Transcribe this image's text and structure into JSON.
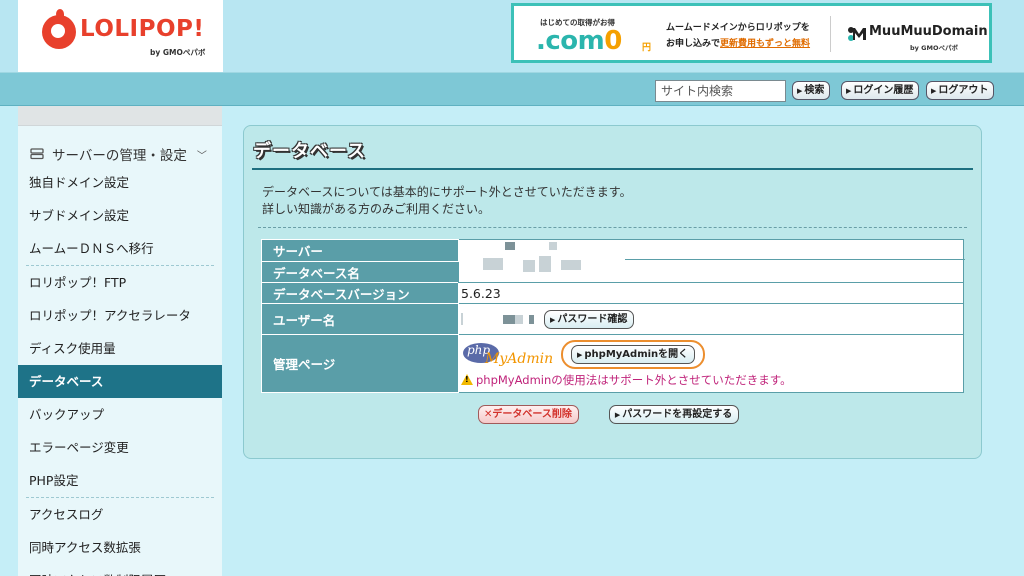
{
  "header": {
    "logo_text": "LOLIPOP!",
    "logo_sub": "by GMOペパボ",
    "banner": {
      "small": "はじめての取得がお得",
      "com": ".com",
      "zero": "0",
      "yen": "円",
      "line1": "ムームードメインからロリポップを",
      "line2_prefix": "お申し込みで",
      "line2_emph": "更新費用もずっと無料",
      "partner": "MuuMuuDomain",
      "partner_sub": "by GMOペパボ"
    }
  },
  "toolbar": {
    "search_placeholder": "サイト内検索",
    "search_button": "検索",
    "login_history_button": "ログイン履歴",
    "logout_button": "ログアウト"
  },
  "sidebar": {
    "section_title": "サーバーの管理・設定",
    "groups": [
      [
        "独自ドメイン設定",
        "サブドメイン設定",
        "ムームーＤＮＳへ移行"
      ],
      [
        "ロリポップ！FTP",
        "ロリポップ！アクセラレータ",
        "ディスク使用量",
        "データベース",
        "バックアップ",
        "エラーページ変更",
        "PHP設定"
      ],
      [
        "アクセスログ",
        "同時アクセス数拡張",
        "同時アクセス数制限履歴"
      ]
    ],
    "active_item": "データベース"
  },
  "main": {
    "title": "データベース",
    "intro_line1": "データベースについては基本的にサポート外とさせていただきます。",
    "intro_line2": "詳しい知識がある方のみご利用ください。",
    "rows": {
      "server_label": "サーバー",
      "db_name_label": "データベース名",
      "db_version_label": "データベースバージョン",
      "db_version_value": "5.6.23",
      "user_label": "ユーザー名",
      "password_check_button": "パスワード確認",
      "admin_label": "管理ページ",
      "php_logo_php": "php",
      "php_logo_my": "MyAdmin",
      "phpmyadmin_button": "phpMyAdminを開く",
      "warning": "phpMyAdminの使用法はサポート外とさせていただきます。"
    },
    "delete_button": "データベース削除",
    "reset_password_button": "パスワードを再設定する"
  },
  "colors": {
    "brand_red": "#e8402c",
    "active_nav": "#1e7388",
    "table_header": "#5a9ea8",
    "highlight_ring": "#ec8e2e",
    "warning_text": "#c0237a"
  }
}
